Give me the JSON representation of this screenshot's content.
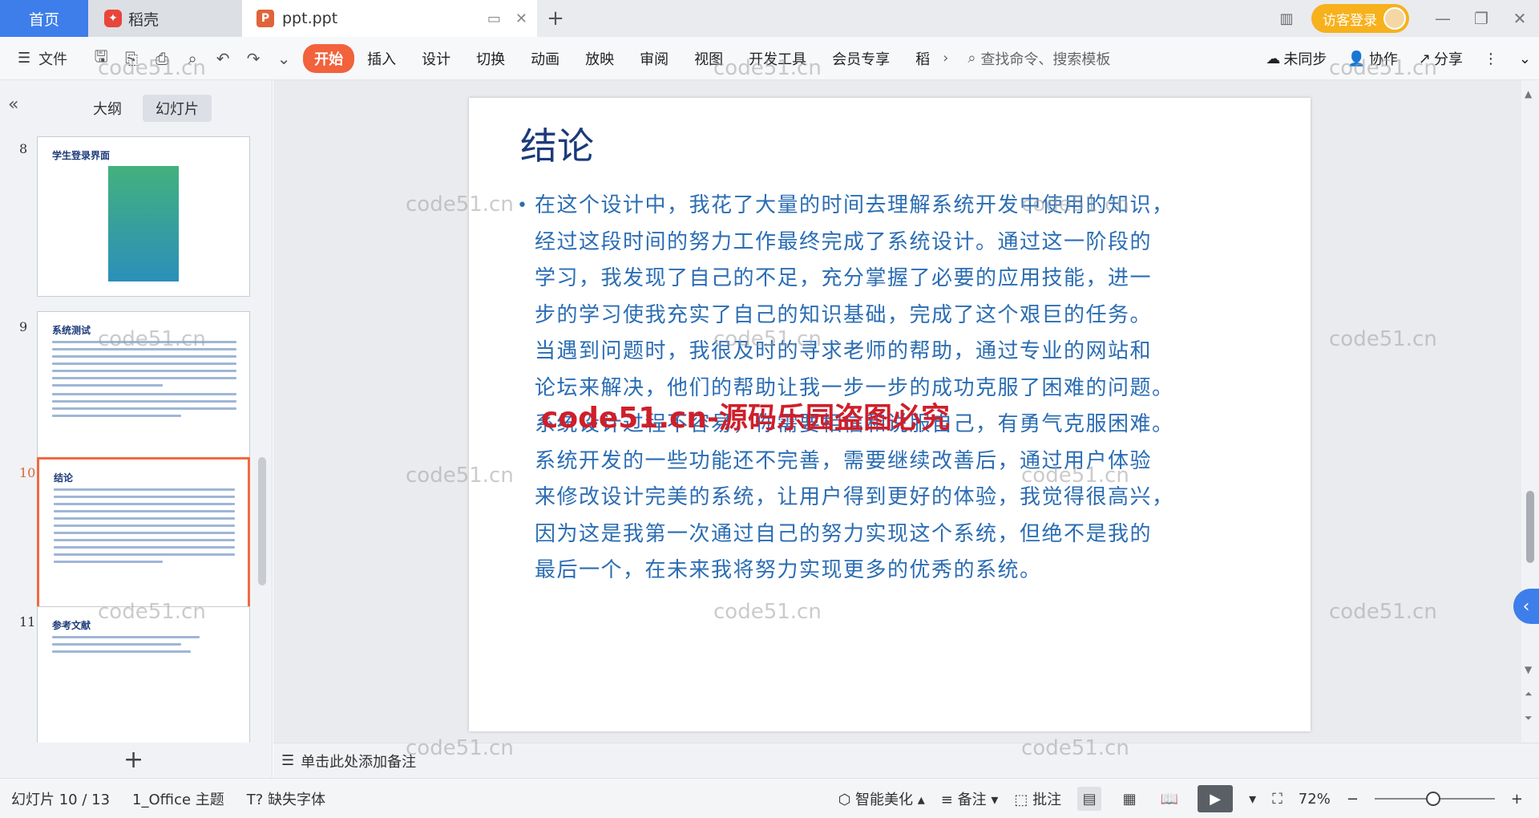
{
  "tabs": {
    "home": "首页",
    "daoke": "稻壳",
    "doc": "ppt.ppt",
    "new": "+"
  },
  "titlebar": {
    "login": "访客登录"
  },
  "menu": {
    "file": "文件",
    "tabs": [
      "开始",
      "插入",
      "设计",
      "切换",
      "动画",
      "放映",
      "审阅",
      "视图",
      "开发工具",
      "会员专享",
      "稻"
    ],
    "search_placeholder": "查找命令、搜索模板",
    "sync": "未同步",
    "collab": "协作",
    "share": "分享"
  },
  "left_panel": {
    "tab_outline": "大纲",
    "tab_slides": "幻灯片",
    "thumbnails": [
      {
        "num": "8",
        "title": "学生登录界面"
      },
      {
        "num": "9",
        "title": "系统测试"
      },
      {
        "num": "10",
        "title": "结论"
      },
      {
        "num": "11",
        "title": "参考文献"
      }
    ]
  },
  "slide": {
    "title": "结论",
    "lines": [
      "在这个设计中，我花了大量的时间去理解系统开发中使用的知识，",
      "经过这段时间的努力工作最终完成了系统设计。通过这一阶段的",
      "学习，我发现了自己的不足，充分掌握了必要的应用技能，进一",
      "步的学习使我充实了自己的知识基础，完成了这个艰巨的任务。",
      "当遇到问题时，我很及时的寻求老师的帮助，通过专业的网站和",
      "论坛来解决，他们的帮助让我一步一步的成功克服了困难的问题。",
      "系统设计过程不容易，你需要相信和说服自己，有勇气克服困难。",
      "系统开发的一些功能还不完善，需要继续改善后，通过用户体验",
      "来修改设计完美的系统，让用户得到更好的体验，我觉得很高兴，",
      "因为这是我第一次通过自己的努力实现这个系统，但绝不是我的",
      "最后一个，在未来我将努力实现更多的优秀的系统。"
    ]
  },
  "notes": "单击此处添加备注",
  "watermark": {
    "text": "code51.cn",
    "red": "code51.cn-源码乐园盗图必究"
  },
  "status": {
    "slide_info": "幻灯片 10 / 13",
    "theme": "1_Office 主题",
    "missing_font": "缺失字体",
    "beautify": "智能美化",
    "notes": "备注",
    "comment": "批注",
    "zoom": "72%"
  }
}
